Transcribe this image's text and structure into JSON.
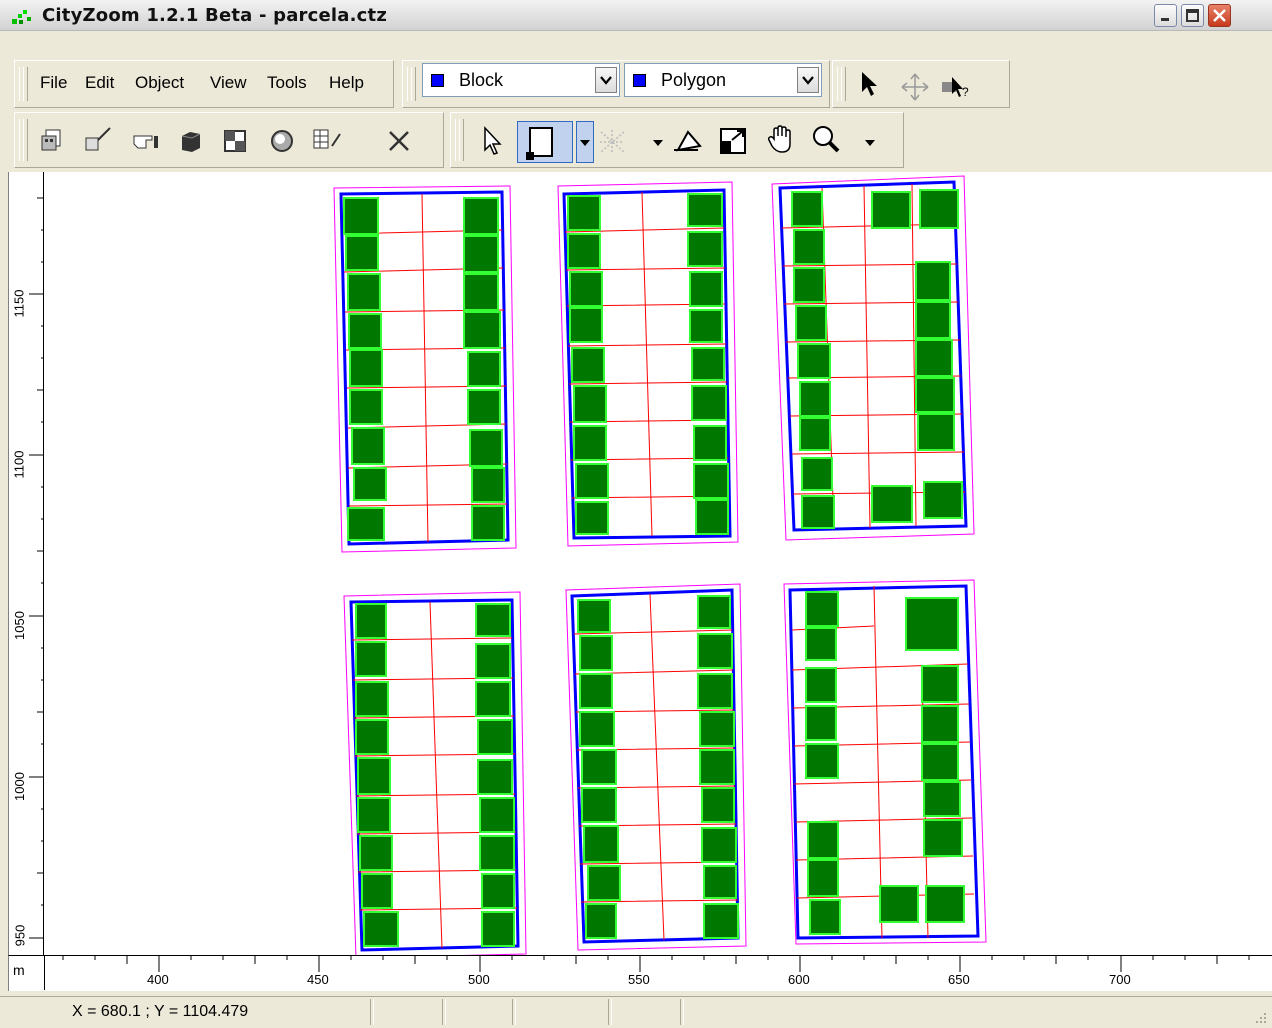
{
  "window": {
    "title": "CityZoom 1.2.1 Beta - parcela.ctz"
  },
  "menu": {
    "items": [
      {
        "label": "File"
      },
      {
        "label": "Edit"
      },
      {
        "label": "Object"
      },
      {
        "label": "View"
      },
      {
        "label": "Tools"
      },
      {
        "label": "Help"
      }
    ]
  },
  "layer_selects": {
    "object_type": {
      "value": "Block",
      "swatch_color": "#0000ff"
    },
    "shape_type": {
      "value": "Polygon",
      "swatch_color": "#0000ff"
    }
  },
  "toolbar_icons": {
    "top_right": [
      "pointer-icon",
      "move-icon",
      "help-cursor-icon"
    ],
    "bottom_left": [
      "buildings-icon",
      "eraser-icon",
      "hand-pointer-icon",
      "cube-icon",
      "window-icon",
      "globe-icon",
      "table-edit-icon",
      "delete-icon"
    ],
    "bottom_right": [
      "select-arrow-icon",
      "rectangle-tool-icon",
      "dropdown-arrow-icon",
      "disabled-grid-icon",
      "dropdown-arrow-icon",
      "polygon-tool-icon",
      "zoom-extents-icon",
      "pan-hand-icon",
      "zoom-icon",
      "dropdown-arrow-icon"
    ]
  },
  "rulers": {
    "unit": "m",
    "x_ticks": [
      "400",
      "450",
      "500",
      "550",
      "600",
      "650",
      "700"
    ],
    "y_ticks": [
      "1150",
      "1100",
      "1050",
      "1000",
      "950"
    ]
  },
  "status": {
    "coordinates": "X = 680.1 ;  Y = 1104.479"
  },
  "colors": {
    "block_outline": "#0000ff",
    "block_buffer": "#ff00ff",
    "parcel_lines": "#ff0000",
    "building_fill": "#007800",
    "building_border": "#33ff33"
  }
}
